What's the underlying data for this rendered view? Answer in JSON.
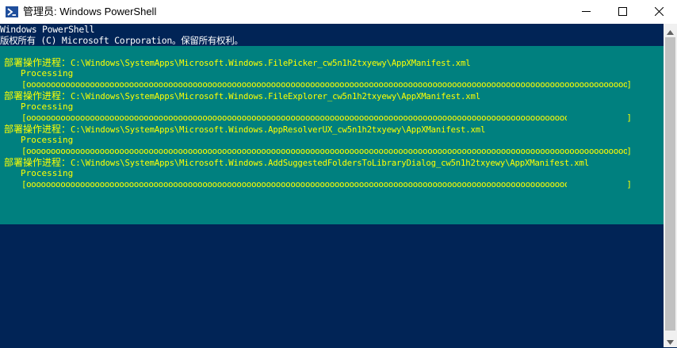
{
  "window": {
    "title": "管理员: Windows PowerShell",
    "icon": "powershell-icon",
    "controls": [
      "minimize-icon",
      "maximize-icon",
      "close-icon"
    ]
  },
  "console": {
    "banner": [
      "Windows PowerShell",
      "版权所有 (C) Microsoft Corporation。保留所有权利。"
    ],
    "progress": [
      {
        "activity_label": "部署操作进程：",
        "activity_path": "C:\\Windows\\SystemApps\\Microsoft.Windows.FilePicker_cw5n1h2txyewy\\AppXManifest.xml",
        "status": "Processing",
        "bar_open": "[",
        "bar_close": "]",
        "bar_fill": "oooooooooooooooooooooooooooooooooooooooooooooooooooooooooooooooooooooooooooooooooooooooooooooooooooooooooooooooooooooooooooooooooooo",
        "percent": 100
      },
      {
        "activity_label": "部署操作进程：",
        "activity_path": "C:\\Windows\\SystemApps\\Microsoft.Windows.FileExplorer_cw5n1h2txyewy\\AppXManifest.xml",
        "status": "Processing",
        "bar_open": "[",
        "bar_close": "]",
        "bar_fill": "oooooooooooooooooooooooooooooooooooooooooooooooooooooooooooooooooooooooooooooooooooooooooooooooooooooooooooooooooooooooooooooooooooo",
        "percent": 90
      },
      {
        "activity_label": "部署操作进程：",
        "activity_path": "C:\\Windows\\SystemApps\\Microsoft.Windows.AppResolverUX_cw5n1h2txyewy\\AppXManifest.xml",
        "status": "Processing",
        "bar_open": "[",
        "bar_close": "]",
        "bar_fill": "oooooooooooooooooooooooooooooooooooooooooooooooooooooooooooooooooooooooooooooooooooooooooooooooooooooooooooooooooooooooooooooooooooo",
        "percent": 100
      },
      {
        "activity_label": "部署操作进程：",
        "activity_path": "C:\\Windows\\SystemApps\\Microsoft.Windows.AddSuggestedFoldersToLibraryDialog_cw5n1h2txyewy\\AppXManifest.xml",
        "status": "Processing",
        "bar_open": "[",
        "bar_close": "]",
        "bar_fill": "oooooooooooooooooooooooooooooooooooooooooooooooooooooooooooooooooooooooooooooooooooooooooooooooooooooooooooooooooooooooooooooooooooo",
        "percent": 90
      }
    ]
  },
  "scrollbar": {
    "up_icon": "scroll-up-arrow-icon",
    "down_icon": "scroll-down-arrow-icon"
  },
  "colors": {
    "console_bg": "#012456",
    "progress_bg": "#00807f",
    "progress_text": "#ffff00",
    "banner_text": "#ffffff",
    "titlebar_bg": "#ffffff"
  }
}
